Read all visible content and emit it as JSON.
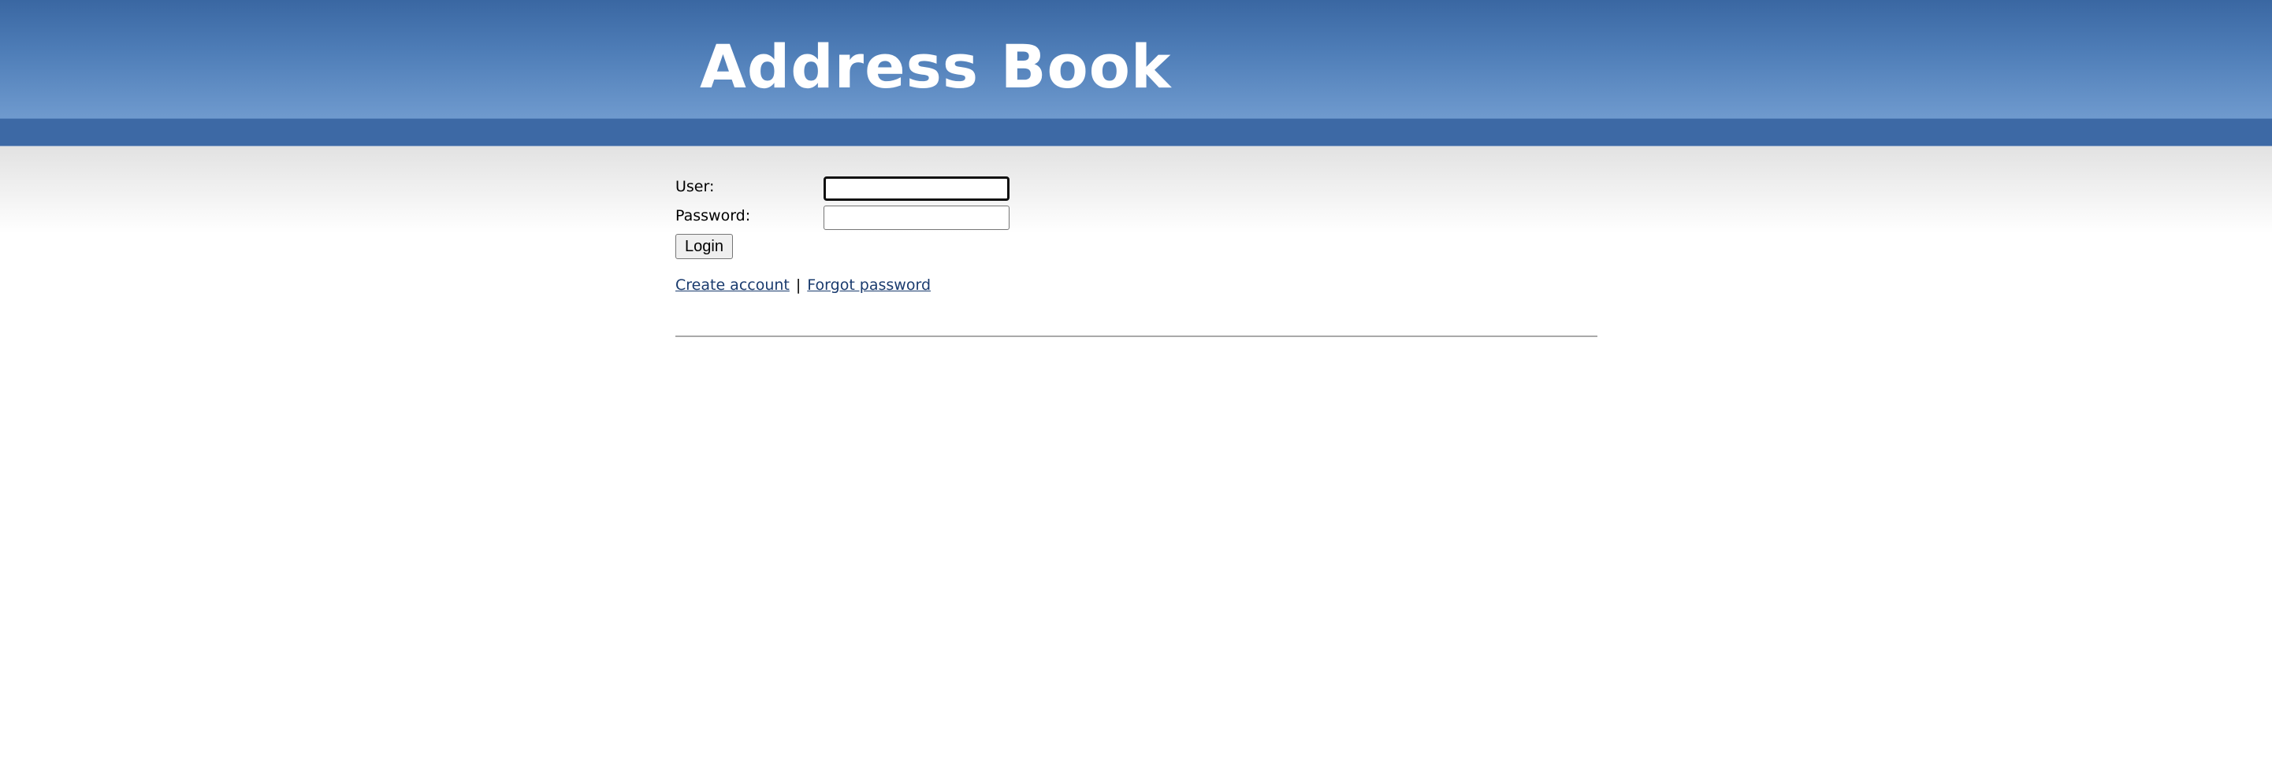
{
  "app": {
    "title": "Address Book"
  },
  "login_form": {
    "user_label": "User:",
    "user_value": "",
    "password_label": "Password:",
    "password_value": "",
    "login_button_label": "Login"
  },
  "links": {
    "create_account": "Create account",
    "separator": "|",
    "forgot_password": "Forgot password"
  },
  "colors": {
    "header_blue": "#3a67a2",
    "link_color": "#1a3b6e"
  }
}
